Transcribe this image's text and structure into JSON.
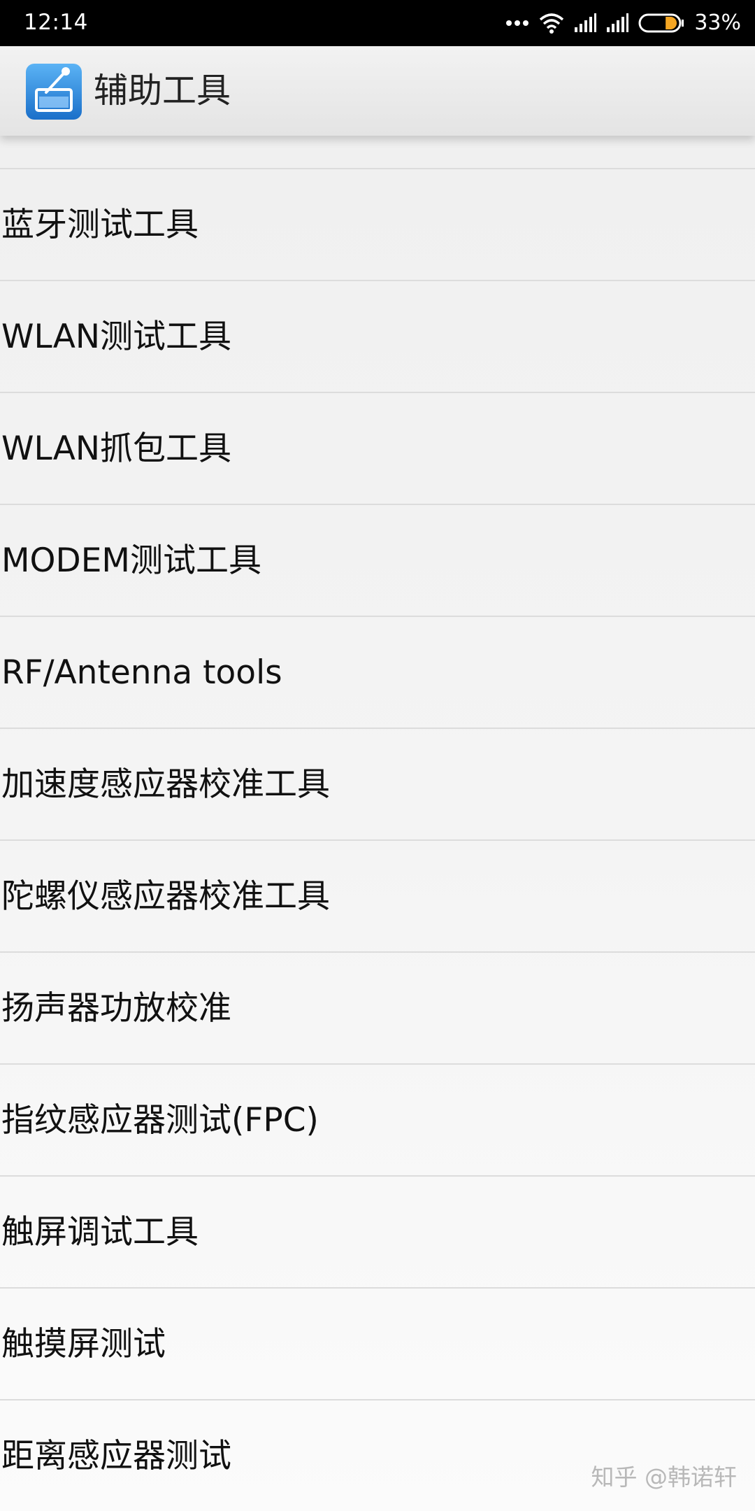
{
  "status_bar": {
    "time": "12:14",
    "battery_percent": "33%",
    "battery_level": 0.33,
    "icons": [
      "more-dots-icon",
      "wifi-icon",
      "signal-1-icon",
      "signal-2-icon",
      "battery-icon"
    ]
  },
  "action_bar": {
    "app_icon": "toolbox-icon",
    "title": "辅助工具"
  },
  "list": {
    "items": [
      {
        "label": "蓝牙测试工具"
      },
      {
        "label": "WLAN测试工具"
      },
      {
        "label": "WLAN抓包工具"
      },
      {
        "label": "MODEM测试工具"
      },
      {
        "label": "RF/Antenna tools"
      },
      {
        "label": "加速度感应器校准工具"
      },
      {
        "label": "陀螺仪感应器校准工具"
      },
      {
        "label": "扬声器功放校准"
      },
      {
        "label": "指纹感应器测试(FPC)"
      },
      {
        "label": "触屏调试工具"
      },
      {
        "label": "触摸屏测试"
      },
      {
        "label": "距离感应器测试"
      }
    ]
  },
  "watermark": "知乎 @韩诺轩",
  "colors": {
    "status_bar_bg": "#000000",
    "battery_fill": "#f5a623",
    "app_icon_blue": "#2f8fe0",
    "divider": "#dcdcdc"
  }
}
